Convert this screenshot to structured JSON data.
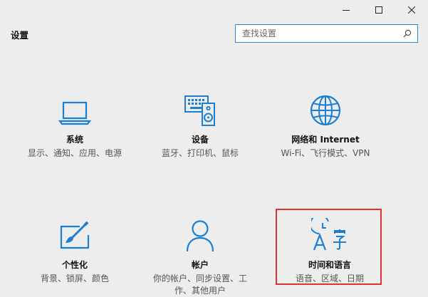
{
  "window": {
    "title": "设置",
    "controls": {
      "minimize": "minimize-icon",
      "maximize": "maximize-icon",
      "close": "close-icon"
    }
  },
  "search": {
    "placeholder": "查找设置",
    "icon": "search-icon"
  },
  "tiles": [
    {
      "id": "system",
      "name": "系统",
      "desc": "显示、通知、应用、电源",
      "icon": "laptop-icon"
    },
    {
      "id": "devices",
      "name": "设备",
      "desc": "蓝牙、打印机、鼠标",
      "icon": "keyboard-speaker-icon"
    },
    {
      "id": "network",
      "name": "网络和 Internet",
      "desc": "Wi-Fi、飞行模式、VPN",
      "icon": "globe-icon"
    },
    {
      "id": "personalization",
      "name": "个性化",
      "desc": "背景、锁屏、颜色",
      "icon": "paint-brush-icon"
    },
    {
      "id": "accounts",
      "name": "帐户",
      "desc": "你的帐户、同步设置、工作、其他用户",
      "icon": "person-icon"
    },
    {
      "id": "time-language",
      "name": "时间和语言",
      "desc": "语音、区域、日期",
      "icon": "time-language-icon"
    }
  ],
  "colors": {
    "accent": "#1a7fd4",
    "background": "#ededed",
    "highlight_border": "#e0302f",
    "search_border": "#2b8ad8"
  }
}
